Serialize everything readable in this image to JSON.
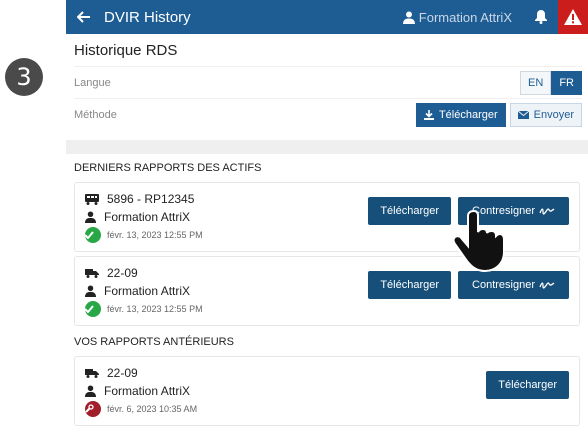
{
  "step": {
    "number": "3"
  },
  "appbar": {
    "title": "DVIR History",
    "user": "Formation AttriX"
  },
  "settings": {
    "title": "Historique RDS",
    "language_label": "Langue",
    "lang_en": "EN",
    "lang_fr": "FR",
    "method_label": "Méthode",
    "download_label": "Télécharger",
    "send_label": "Envoyer"
  },
  "recent": {
    "title": "DERNIERS RAPPORTS DES ACTIFS",
    "items": [
      {
        "vehicle_icon": "bus-icon",
        "asset": "5896 - RP12345",
        "driver": "Formation AttriX",
        "date": "févr. 13, 2023 12:55 PM",
        "status": "ok",
        "download_label": "Télécharger",
        "countersign_label": "Contresigner"
      },
      {
        "vehicle_icon": "truck-icon",
        "asset": "22-09",
        "driver": "Formation AttriX",
        "date": "févr. 13, 2023 12:55 PM",
        "status": "ok",
        "download_label": "Télécharger",
        "countersign_label": "Contresigner"
      }
    ]
  },
  "previous": {
    "title": "VOS RAPPORTS ANTÉRIEURS",
    "items": [
      {
        "vehicle_icon": "truck-icon",
        "asset": "22-09",
        "driver": "Formation AttriX",
        "date": "févr. 6, 2023 10:35 AM",
        "status": "defect",
        "download_label": "Télécharger"
      }
    ]
  },
  "colors": {
    "primary": "#1e5d94",
    "button": "#174f7b",
    "alert": "#cc1d1d",
    "ok": "#27a745",
    "defect": "#a01f2b"
  }
}
